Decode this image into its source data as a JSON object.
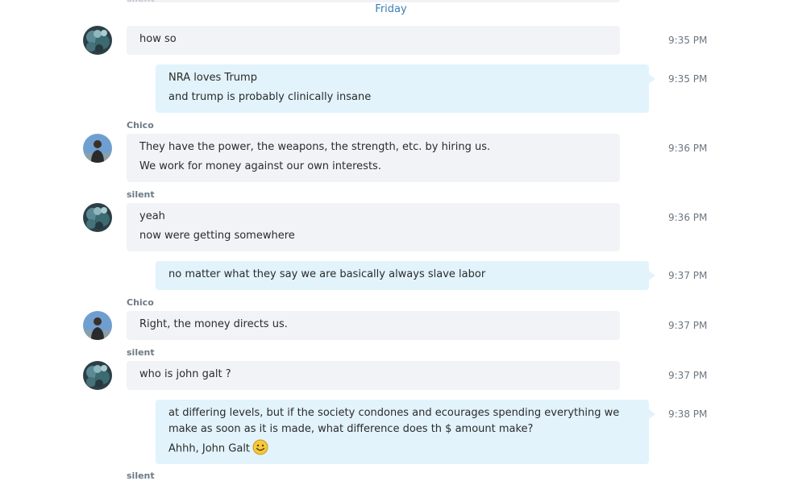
{
  "date_separator": "Friday",
  "top_cut_sender": "silent",
  "bottom_cut_sender": "silent",
  "colors": {
    "incoming_bubble": "#f1f3f7",
    "outgoing_bubble": "#e2f3fb",
    "date_separator": "#3d7fb3",
    "sender_name": "#6c7985",
    "timestamp": "#6b7683"
  },
  "messages": [
    {
      "direction": "incoming",
      "sender": "",
      "avatar": "avatar-silent",
      "lines": [
        "how so"
      ],
      "time": "9:35 PM"
    },
    {
      "direction": "outgoing",
      "lines": [
        "NRA loves Trump",
        "and trump is probably clinically insane"
      ],
      "time": "9:35 PM"
    },
    {
      "direction": "incoming",
      "sender": "Chico",
      "avatar": "avatar-chico",
      "lines": [
        "They have the power, the weapons, the strength, etc. by hiring us.",
        "We work for money against our own interests."
      ],
      "time": "9:36 PM"
    },
    {
      "direction": "incoming",
      "sender": "silent",
      "avatar": "avatar-silent",
      "lines": [
        "yeah",
        "now were getting somewhere"
      ],
      "time": "9:36 PM"
    },
    {
      "direction": "outgoing",
      "lines": [
        "no matter what they say we are basically always slave labor"
      ],
      "time": "9:37 PM"
    },
    {
      "direction": "incoming",
      "sender": "Chico",
      "avatar": "avatar-chico",
      "lines": [
        "Right, the money directs us."
      ],
      "time": "9:37 PM"
    },
    {
      "direction": "incoming",
      "sender": "silent",
      "avatar": "avatar-silent",
      "lines": [
        "who is john galt ?"
      ],
      "time": "9:37 PM"
    },
    {
      "direction": "outgoing",
      "lines": [
        "at differing levels, but if the society condones and ecourages spending everything we make as soon as it is made, what difference does th $ amount make?",
        "Ahhh, John Galt"
      ],
      "emoji": "smile-emoji-icon",
      "time": "9:38 PM"
    }
  ]
}
